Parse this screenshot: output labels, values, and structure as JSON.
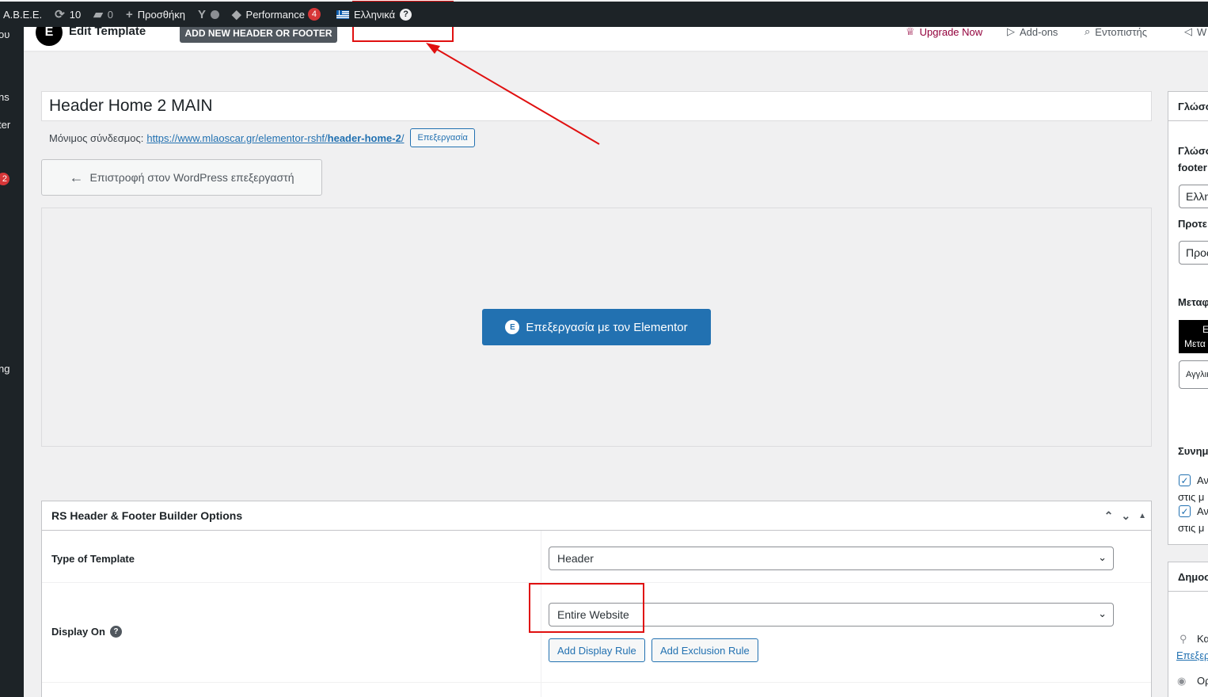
{
  "adminbar": {
    "site_name": "Α.Β.Ε.Ε.",
    "updates_count": "10",
    "comments_count": "0",
    "new_label": "Προσθήκη",
    "performance_label": "Performance",
    "performance_badge": "4",
    "language_label": "Ελληνικά",
    "language_help": "?"
  },
  "sidemenu": {
    "items": [
      "ου",
      "ns",
      "ter",
      "2",
      "ng"
    ]
  },
  "topbar": {
    "logo_glyph": "E",
    "title": "Edit Template",
    "add_new_label": "ADD NEW HEADER OR FOOTER",
    "upgrade_label": "Upgrade Now",
    "addons_label": "Add-ons",
    "search_label": "Εντοπιστής",
    "extra_label": "W"
  },
  "post": {
    "title": "Header Home 2 MAIN",
    "permalink_label": "Μόνιμος σύνδεσμος:",
    "permalink_base": "https://www.mlaoscar.gr/elementor-rshf/",
    "permalink_slug": "header-home-2",
    "permalink_end": "/",
    "permalink_edit_label": "Επεξεργασία",
    "back_label": "Επιστροφή στον WordPress επεξεργαστή",
    "elementor_label": "Επεξεργασία με τον Elementor",
    "elementor_badge": "E"
  },
  "metabox": {
    "title": "RS Header & Footer Builder Options",
    "type_label": "Type of Template",
    "type_value": "Header",
    "display_label": "Display On",
    "display_value": "Entire Website",
    "add_display_rule": "Add Display Rule",
    "add_exclusion_rule": "Add Exclusion Rule"
  },
  "sidebar": {
    "box1_title": "Γλώσσ",
    "lang_label_1": "Γλώσσ",
    "lang_label_2": "footer",
    "lang_value": "Ελλη",
    "proto_label": "Προτε",
    "proto_value": "Προς",
    "meta_label": "Μεταφ",
    "meta_btn_1": "Ε",
    "meta_btn_2": "Μετα",
    "meta_en": "Αγγλικ",
    "sync_label": "Συνημ",
    "chk1_a": "Αν",
    "chk1_b": "στις μ",
    "chk2_a": "Αν",
    "chk2_b": "στις μ",
    "box2_title": "Δημοσ",
    "pin_label": "Κα",
    "pin_link": "Επεξερ",
    "eye_label": "Ορ"
  },
  "annotation_color": "#e01010"
}
